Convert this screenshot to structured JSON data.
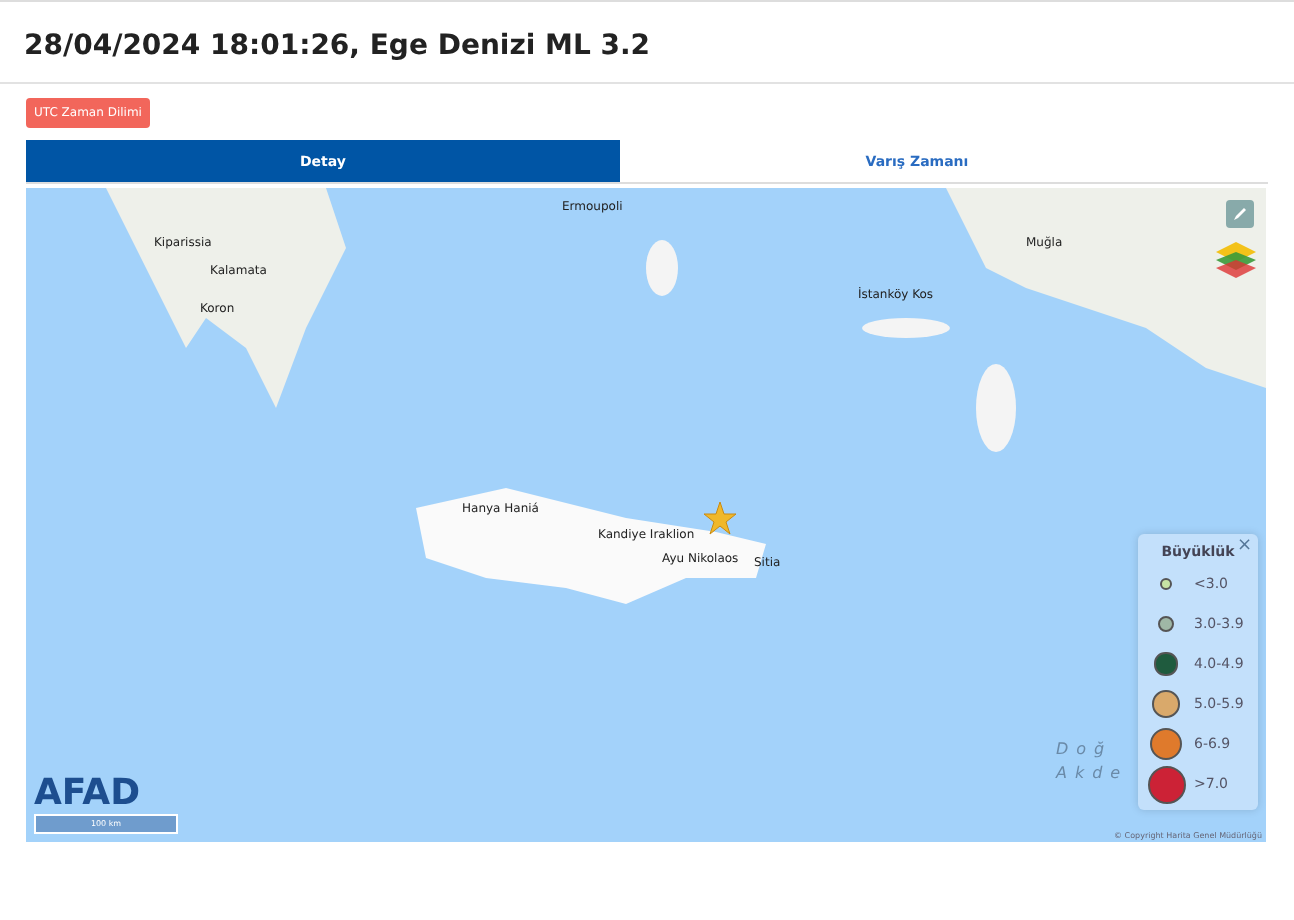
{
  "title": "28/04/2024 18:01:26, Ege Denizi ML 3.2",
  "timezone_button": "UTC Zaman Dilimi",
  "tabs": [
    {
      "label": "Detay",
      "selected": true
    },
    {
      "label": "Varış Zamanı",
      "selected": false
    }
  ],
  "map": {
    "places": [
      "Kiparissia",
      "Kalamata",
      "Koron",
      "Ermoupoli",
      "Muğla",
      "İstanköy Kos",
      "Hanya Haniá",
      "Kandiye Iraklion",
      "Ayu Nikolaos",
      "Sitia"
    ],
    "sea_label": "Doğ Akde",
    "logo": "AFAD",
    "legend_close": "×",
    "scale": "100 km",
    "copyright": "© Copyright Harita Genel Müdürlüğü",
    "legend": {
      "title": "Büyüklük",
      "items": [
        {
          "label": "<3.0",
          "color": "#c6e3a4"
        },
        {
          "label": "3.0-3.9",
          "color": "#9fb7a6"
        },
        {
          "label": "4.0-4.9",
          "color": "#1f5b3e"
        },
        {
          "label": "5.0-5.9",
          "color": "#d9a96b"
        },
        {
          "label": "6-6.9",
          "color": "#df7a2c"
        },
        {
          "label": ">7.0",
          "color": "#cc2236"
        }
      ]
    }
  }
}
